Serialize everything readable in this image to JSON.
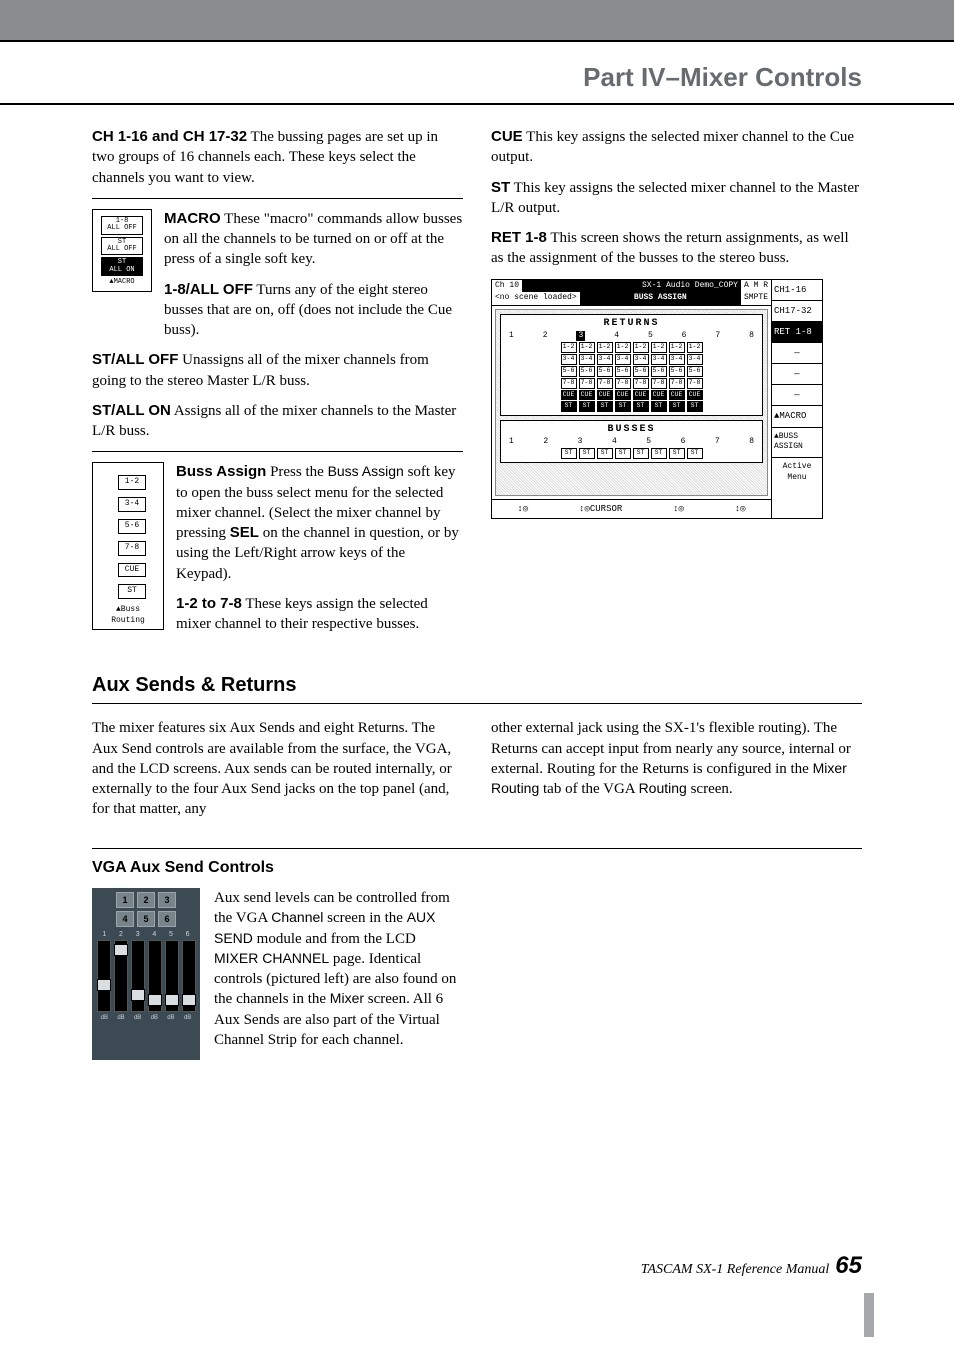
{
  "header": {
    "part_title": "Part IV–Mixer Controls"
  },
  "left": {
    "ch_title": "CH 1-16 and CH 17-32",
    "ch_body": " The bussing pages are set up in two groups of 16 channels each. These keys select the channels you want to view.",
    "macro": {
      "title": "MACRO",
      "body": " These \"macro\" commands allow busses on all the channels to be turned on or off at the press of a single soft key.",
      "k1_title": "1-8/ALL OFF",
      "k1_body": " Turns any of the eight stereo busses that are on, off (does not include the Cue buss).",
      "fig": {
        "b1a": "1-8",
        "b1b": "ALL OFF",
        "b2a": "ST",
        "b2b": "ALL OFF",
        "b3a": "ST",
        "b3b": "ALL ON",
        "cap": "▲MACRO"
      }
    },
    "stoff_title": "ST/ALL OFF",
    "stoff_body": " Unassigns all of the mixer channels from going to the stereo Master L/R buss.",
    "ston_title": "ST/ALL ON",
    "ston_body": " Assigns all of the mixer channels to the Master L/R buss.",
    "bussassign": {
      "title": "Buss Assign",
      "body_a": " Press the ",
      "body_key": "Buss Assign",
      "body_b": " soft key to open the buss select menu for the selected mixer channel. (Select the mixer channel by pressing ",
      "body_sel": "SEL",
      "body_c": " on the channel in question, or by using the Left/Right arrow keys of the Keypad).",
      "k2_title": "1-2 to 7-8",
      "k2_body": " These keys assign the selected mixer channel to their respective busses.",
      "fig": {
        "c1": "1-2",
        "c2": "3-4",
        "c3": "5-6",
        "c4": "7-8",
        "c5": "CUE",
        "c6": "ST",
        "cap": "▲Buss\nRouting"
      }
    }
  },
  "right": {
    "cue_title": "CUE",
    "cue_body": " This key assigns the selected mixer channel to the Cue output.",
    "st_title": "ST",
    "st_body": " This key assigns the selected mixer channel to the Master L/R output.",
    "ret_title": "RET 1-8",
    "ret_body": " This screen shows the return assignments, as well as the assignment of the busses to the stereo buss."
  },
  "lcd": {
    "tb_left": "Ch 10",
    "tb_mid": "SX-1 Audio Demo_COPY",
    "tb_icons": "A M R",
    "sub_left": "<no scene loaded>",
    "sub_mid": "BUSS ASSIGN",
    "sub_right": "SMPTE",
    "returns": "RETURNS",
    "busses": "BUSSES",
    "nums": [
      "1",
      "2",
      "3",
      "4",
      "5",
      "6",
      "7",
      "8"
    ],
    "row12": [
      "1-2",
      "1-2",
      "1-2",
      "1-2",
      "1-2",
      "1-2",
      "1-2",
      "1-2"
    ],
    "row34": [
      "3-4",
      "3-4",
      "3-4",
      "3-4",
      "3-4",
      "3-4",
      "3-4",
      "3-4"
    ],
    "row56": [
      "5-6",
      "5-6",
      "5-6",
      "5-6",
      "5-6",
      "5-6",
      "5-6",
      "5-6"
    ],
    "row78": [
      "7-8",
      "7-8",
      "7-8",
      "7-8",
      "7-8",
      "7-8",
      "7-8",
      "7-8"
    ],
    "rowcue": [
      "CUE",
      "CUE",
      "CUE",
      "CUE",
      "CUE",
      "CUE",
      "CUE",
      "CUE"
    ],
    "rowst": [
      "ST",
      "ST",
      "ST",
      "ST",
      "ST",
      "ST",
      "ST",
      "ST"
    ],
    "footer_cursor": "↕◎CURSOR",
    "footer_enc": "↕◎",
    "side": {
      "ch116": "CH1-16",
      "ch1732": "CH17-32",
      "ret": "RET 1-8",
      "dash": "—",
      "macro": "▲MACRO",
      "buss": "▲BUSS\nASSIGN",
      "active": "Active\nMenu"
    }
  },
  "aux": {
    "section": "Aux Sends & Returns",
    "p1": "The mixer features six Aux Sends and eight Returns. The Aux Send controls are available from the surface, the VGA, and the LCD screens. Aux sends can be routed internally, or externally to the four Aux Send jacks on the top panel (and, for that matter, any",
    "p2a": "other external jack using the SX-1's flexible routing). The Returns can accept input from nearly any source, internal or external. Routing for the Returns is configured in the ",
    "p2_key1": "Mixer Routing",
    "p2b": " tab of the VGA ",
    "p2_key2": "Routing",
    "p2c": " screen.",
    "sub": "VGA Aux Send Controls",
    "sub_body_a": "Aux send levels can be controlled from the VGA ",
    "sub_key1": "Channel",
    "sub_body_b": " screen in the ",
    "sub_key2": "AUX SEND",
    "sub_body_c": " module and from the LCD ",
    "sub_key3": "MIXER CHANNEL",
    "sub_body_d": " page. Identical controls (pictured left) are also found on the channels in the ",
    "sub_key4": "Mixer",
    "sub_body_e": " screen. All 6 Aux Sends are also part of the Virtual Channel Strip for each channel.",
    "fig": {
      "btns": [
        "1",
        "2",
        "3",
        "4",
        "5",
        "6"
      ],
      "scale": [
        "1",
        "2",
        "3",
        "4",
        "5",
        "6"
      ],
      "db": [
        "dB",
        "dB",
        "dB",
        "dB",
        "dB",
        "dB"
      ]
    }
  },
  "footer": {
    "ref": "TASCAM SX-1 Reference Manual ",
    "page": "65"
  }
}
